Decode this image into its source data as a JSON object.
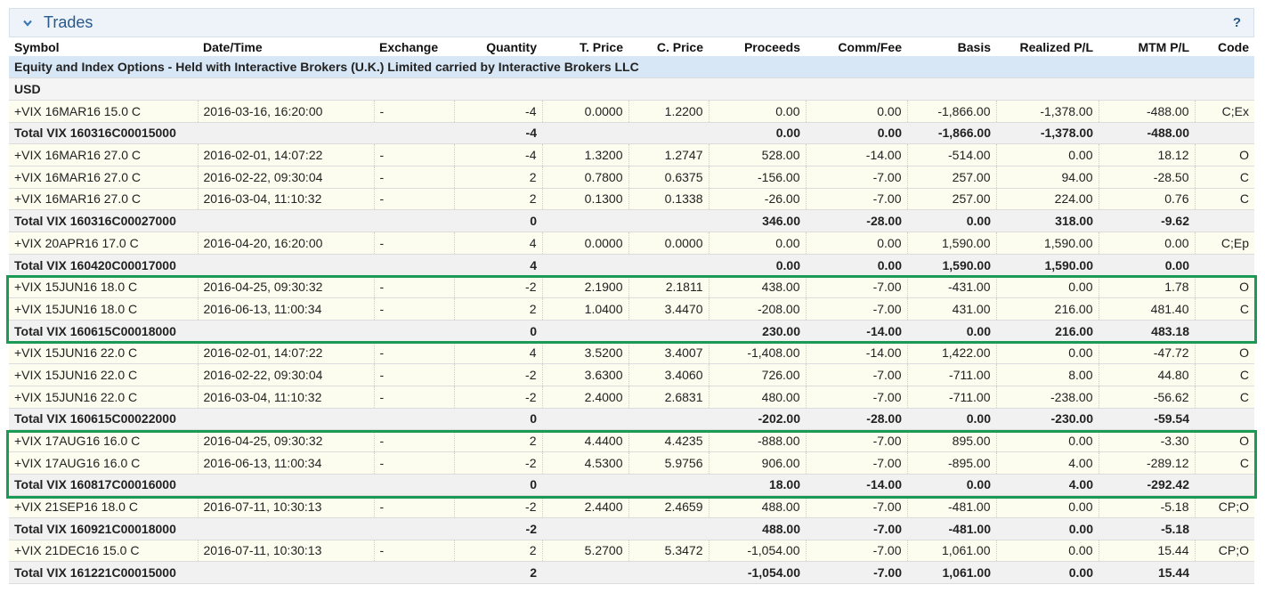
{
  "panel": {
    "title": "Trades",
    "help": "?"
  },
  "columns": [
    "Symbol",
    "Date/Time",
    "Exchange",
    "Quantity",
    "T. Price",
    "C. Price",
    "Proceeds",
    "Comm/Fee",
    "Basis",
    "Realized P/L",
    "MTM P/L",
    "Code"
  ],
  "section_title": "Equity and Index Options - Held with Interactive Brokers (U.K.) Limited carried by Interactive Brokers LLC",
  "currency": "USD",
  "highlight_color": "#1a9a55",
  "rows": [
    {
      "type": "data",
      "symbol": "+VIX 16MAR16 15.0 C",
      "datetime": "2016-03-16, 16:20:00",
      "exchange": "-",
      "quantity": "-4",
      "tprice": "0.0000",
      "cprice": "1.2200",
      "proceeds": "0.00",
      "commfee": "0.00",
      "basis": "-1,866.00",
      "realized": "-1,378.00",
      "mtm": "-488.00",
      "code": "C;Ex"
    },
    {
      "type": "total",
      "symbol": "Total VIX 160316C00015000",
      "quantity": "-4",
      "proceeds": "0.00",
      "commfee": "0.00",
      "basis": "-1,866.00",
      "realized": "-1,378.00",
      "mtm": "-488.00"
    },
    {
      "type": "data",
      "symbol": "+VIX 16MAR16 27.0 C",
      "datetime": "2016-02-01, 14:07:22",
      "exchange": "-",
      "quantity": "-4",
      "tprice": "1.3200",
      "cprice": "1.2747",
      "proceeds": "528.00",
      "commfee": "-14.00",
      "basis": "-514.00",
      "realized": "0.00",
      "mtm": "18.12",
      "code": "O"
    },
    {
      "type": "data",
      "symbol": "+VIX 16MAR16 27.0 C",
      "datetime": "2016-02-22, 09:30:04",
      "exchange": "-",
      "quantity": "2",
      "tprice": "0.7800",
      "cprice": "0.6375",
      "proceeds": "-156.00",
      "commfee": "-7.00",
      "basis": "257.00",
      "realized": "94.00",
      "mtm": "-28.50",
      "code": "C"
    },
    {
      "type": "data",
      "symbol": "+VIX 16MAR16 27.0 C",
      "datetime": "2016-03-04, 11:10:32",
      "exchange": "-",
      "quantity": "2",
      "tprice": "0.1300",
      "cprice": "0.1338",
      "proceeds": "-26.00",
      "commfee": "-7.00",
      "basis": "257.00",
      "realized": "224.00",
      "mtm": "0.76",
      "code": "C"
    },
    {
      "type": "total",
      "symbol": "Total VIX 160316C00027000",
      "quantity": "0",
      "proceeds": "346.00",
      "commfee": "-28.00",
      "basis": "0.00",
      "realized": "318.00",
      "mtm": "-9.62"
    },
    {
      "type": "data",
      "symbol": "+VIX 20APR16 17.0 C",
      "datetime": "2016-04-20, 16:20:00",
      "exchange": "-",
      "quantity": "4",
      "tprice": "0.0000",
      "cprice": "0.0000",
      "proceeds": "0.00",
      "commfee": "0.00",
      "basis": "1,590.00",
      "realized": "1,590.00",
      "mtm": "0.00",
      "code": "C;Ep"
    },
    {
      "type": "total",
      "symbol": "Total VIX 160420C00017000",
      "quantity": "4",
      "proceeds": "0.00",
      "commfee": "0.00",
      "basis": "1,590.00",
      "realized": "1,590.00",
      "mtm": "0.00"
    },
    {
      "type": "data",
      "symbol": "+VIX 15JUN16 18.0 C",
      "datetime": "2016-04-25, 09:30:32",
      "exchange": "-",
      "quantity": "-2",
      "tprice": "2.1900",
      "cprice": "2.1811",
      "proceeds": "438.00",
      "commfee": "-7.00",
      "basis": "-431.00",
      "realized": "0.00",
      "mtm": "1.78",
      "code": "O"
    },
    {
      "type": "data",
      "symbol": "+VIX 15JUN16 18.0 C",
      "datetime": "2016-06-13, 11:00:34",
      "exchange": "-",
      "quantity": "2",
      "tprice": "1.0400",
      "cprice": "3.4470",
      "proceeds": "-208.00",
      "commfee": "-7.00",
      "basis": "431.00",
      "realized": "216.00",
      "mtm": "481.40",
      "code": "C"
    },
    {
      "type": "total",
      "symbol": "Total VIX 160615C00018000",
      "quantity": "0",
      "proceeds": "230.00",
      "commfee": "-14.00",
      "basis": "0.00",
      "realized": "216.00",
      "mtm": "483.18"
    },
    {
      "type": "data",
      "symbol": "+VIX 15JUN16 22.0 C",
      "datetime": "2016-02-01, 14:07:22",
      "exchange": "-",
      "quantity": "4",
      "tprice": "3.5200",
      "cprice": "3.4007",
      "proceeds": "-1,408.00",
      "commfee": "-14.00",
      "basis": "1,422.00",
      "realized": "0.00",
      "mtm": "-47.72",
      "code": "O"
    },
    {
      "type": "data",
      "symbol": "+VIX 15JUN16 22.0 C",
      "datetime": "2016-02-22, 09:30:04",
      "exchange": "-",
      "quantity": "-2",
      "tprice": "3.6300",
      "cprice": "3.4060",
      "proceeds": "726.00",
      "commfee": "-7.00",
      "basis": "-711.00",
      "realized": "8.00",
      "mtm": "44.80",
      "code": "C"
    },
    {
      "type": "data",
      "symbol": "+VIX 15JUN16 22.0 C",
      "datetime": "2016-03-04, 11:10:32",
      "exchange": "-",
      "quantity": "-2",
      "tprice": "2.4000",
      "cprice": "2.6831",
      "proceeds": "480.00",
      "commfee": "-7.00",
      "basis": "-711.00",
      "realized": "-238.00",
      "mtm": "-56.62",
      "code": "C"
    },
    {
      "type": "total",
      "symbol": "Total VIX 160615C00022000",
      "quantity": "0",
      "proceeds": "-202.00",
      "commfee": "-28.00",
      "basis": "0.00",
      "realized": "-230.00",
      "mtm": "-59.54"
    },
    {
      "type": "data",
      "symbol": "+VIX 17AUG16 16.0 C",
      "datetime": "2016-04-25, 09:30:32",
      "exchange": "-",
      "quantity": "2",
      "tprice": "4.4400",
      "cprice": "4.4235",
      "proceeds": "-888.00",
      "commfee": "-7.00",
      "basis": "895.00",
      "realized": "0.00",
      "mtm": "-3.30",
      "code": "O"
    },
    {
      "type": "data",
      "symbol": "+VIX 17AUG16 16.0 C",
      "datetime": "2016-06-13, 11:00:34",
      "exchange": "-",
      "quantity": "-2",
      "tprice": "4.5300",
      "cprice": "5.9756",
      "proceeds": "906.00",
      "commfee": "-7.00",
      "basis": "-895.00",
      "realized": "4.00",
      "mtm": "-289.12",
      "code": "C"
    },
    {
      "type": "total",
      "symbol": "Total VIX 160817C00016000",
      "quantity": "0",
      "proceeds": "18.00",
      "commfee": "-14.00",
      "basis": "0.00",
      "realized": "4.00",
      "mtm": "-292.42"
    },
    {
      "type": "data",
      "symbol": "+VIX 21SEP16 18.0 C",
      "datetime": "2016-07-11, 10:30:13",
      "exchange": "-",
      "quantity": "-2",
      "tprice": "2.4400",
      "cprice": "2.4659",
      "proceeds": "488.00",
      "commfee": "-7.00",
      "basis": "-481.00",
      "realized": "0.00",
      "mtm": "-5.18",
      "code": "CP;O"
    },
    {
      "type": "total",
      "symbol": "Total VIX 160921C00018000",
      "quantity": "-2",
      "proceeds": "488.00",
      "commfee": "-7.00",
      "basis": "-481.00",
      "realized": "0.00",
      "mtm": "-5.18"
    },
    {
      "type": "data",
      "symbol": "+VIX 21DEC16 15.0 C",
      "datetime": "2016-07-11, 10:30:13",
      "exchange": "-",
      "quantity": "2",
      "tprice": "5.2700",
      "cprice": "5.3472",
      "proceeds": "-1,054.00",
      "commfee": "-7.00",
      "basis": "1,061.00",
      "realized": "0.00",
      "mtm": "15.44",
      "code": "CP;O"
    },
    {
      "type": "total",
      "symbol": "Total VIX 161221C00015000",
      "quantity": "2",
      "proceeds": "-1,054.00",
      "commfee": "-7.00",
      "basis": "1,061.00",
      "realized": "0.00",
      "mtm": "15.44"
    }
  ]
}
